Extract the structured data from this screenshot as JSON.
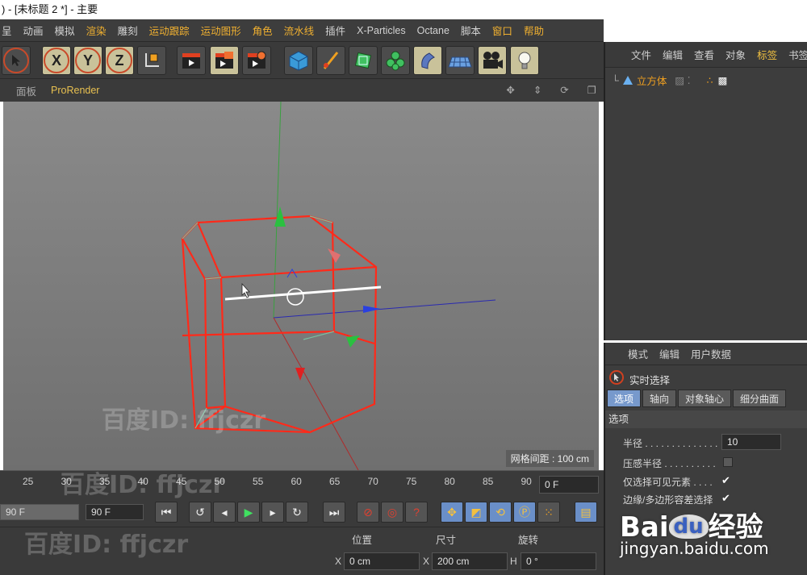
{
  "window": {
    "title": ") - [未标题 2 *] - 主要"
  },
  "menubar": {
    "items": [
      {
        "label": "呈",
        "hl": false
      },
      {
        "label": "动画",
        "hl": false
      },
      {
        "label": "模拟",
        "hl": false
      },
      {
        "label": "渲染",
        "hl": true
      },
      {
        "label": "雕刻",
        "hl": false
      },
      {
        "label": "运动跟踪",
        "hl": true
      },
      {
        "label": "运动图形",
        "hl": true
      },
      {
        "label": "角色",
        "hl": true
      },
      {
        "label": "流水线",
        "hl": true
      },
      {
        "label": "插件",
        "hl": false
      },
      {
        "label": "X-Particles",
        "hl": false
      },
      {
        "label": "Octane",
        "hl": false
      },
      {
        "label": "脚本",
        "hl": false
      },
      {
        "label": "窗口",
        "hl": true
      },
      {
        "label": "帮助",
        "hl": true
      }
    ]
  },
  "toolbar": {
    "x_label": "X",
    "y_label": "Y",
    "z_label": "Z"
  },
  "viewport": {
    "header_items": [
      "面板"
    ],
    "renderer": "ProRender",
    "grid_spacing": "网格间距 : 100 cm"
  },
  "watermark": {
    "text": "百度ID: ffjczr"
  },
  "timeline": {
    "ticks": [
      "25",
      "30",
      "35",
      "40",
      "45",
      "50",
      "55",
      "60",
      "65",
      "70",
      "75",
      "80",
      "85",
      "90"
    ],
    "current_frame": "0 F"
  },
  "transport": {
    "end_frame_slider": "90 F",
    "end_frame_field": "90 F"
  },
  "coords": {
    "position_label": "位置",
    "size_label": "尺寸",
    "rotation_label": "旋转",
    "x_axis": "X",
    "x_pos": "0 cm",
    "x_axis2": "X",
    "x_size": "200 cm",
    "h_axis": "H",
    "h_rot": "0 °"
  },
  "object_manager": {
    "menu": [
      "文件",
      "编辑",
      "查看",
      "对象",
      "标签",
      "书签"
    ],
    "object_name": "立方体"
  },
  "attributes": {
    "menu": [
      "模式",
      "编辑",
      "用户数据"
    ],
    "tool_name": "实时选择",
    "tabs": [
      "选项",
      "轴向",
      "对象轴心",
      "细分曲面"
    ],
    "section": "选项",
    "radius_label": "半径 . . . . . . . . . . . . . .",
    "radius_value": "10",
    "pressure_label": "压感半径 . . . . . . . . . .",
    "visible_only_label": "仅选择可见元素 . . . .",
    "edge_loop_label": "边缘/多边形容差选择"
  },
  "baidu": {
    "logo_a": "Bai",
    "logo_du": "du",
    "logo_b": "经验",
    "url": "jingyan.baidu.com"
  },
  "colors": {
    "accent": "#f0b030",
    "wire": "#ff3020",
    "active_tab": "#7799cc"
  }
}
